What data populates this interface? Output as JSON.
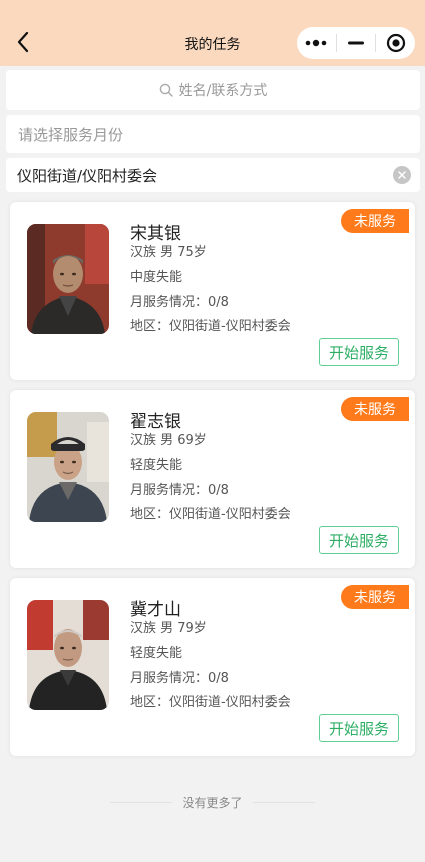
{
  "header": {
    "title": "我的任务",
    "back_icon": "chevron-left-icon",
    "capsule": {
      "more_icon": "more-dots-icon",
      "minimize_icon": "minimize-icon",
      "close_icon": "target-circle-icon"
    },
    "background": "#fbd9bf"
  },
  "search": {
    "placeholder": "姓名/联系方式",
    "icon": "search-icon"
  },
  "filters": {
    "month_placeholder": "请选择服务月份",
    "region_value": "仪阳街道/仪阳村委会",
    "clear_icon": "clear-icon"
  },
  "cards": [
    {
      "name": "宋其银",
      "demographics": "汉族 男   75岁",
      "disability": "中度失能",
      "monthly_service": "月服务情况：0/8",
      "region": "地区：仪阳街道-仪阳村委会",
      "status": "未服务",
      "action": "开始服务"
    },
    {
      "name": "翟志银",
      "demographics": "汉族 男   69岁",
      "disability": "轻度失能",
      "monthly_service": "月服务情况：0/8",
      "region": "地区：仪阳街道-仪阳村委会",
      "status": "未服务",
      "action": "开始服务"
    },
    {
      "name": "冀才山",
      "demographics": "汉族 男   79岁",
      "disability": "轻度失能",
      "monthly_service": "月服务情况：0/8",
      "region": "地区：仪阳街道-仪阳村委会",
      "status": "未服务",
      "action": "开始服务"
    }
  ],
  "footer": {
    "text": "没有更多了"
  },
  "colors": {
    "accent_orange": "#ff7a1a",
    "accent_green": "#2eae65"
  }
}
